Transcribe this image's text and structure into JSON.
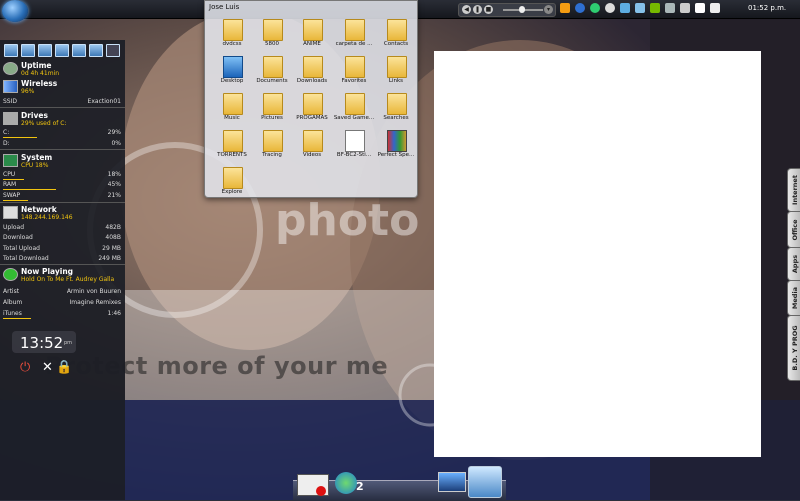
{
  "colors": {
    "accent": "#f1c40f",
    "sidebar": "#1c1e26",
    "panel": "#ffffff"
  },
  "topbar": {
    "clock": "01:52 p.m.",
    "tray_icons": [
      "orange-app-icon",
      "bluetooth-icon",
      "green-app-icon",
      "circle-app-icon",
      "network-icon",
      "network-icon-2",
      "nvidia-icon",
      "shield-icon",
      "device-icon",
      "signal-icon",
      "volume-icon"
    ]
  },
  "sidebar": {
    "uptime": {
      "title": "Uptime",
      "value": "0d 4h 41min"
    },
    "wireless": {
      "title": "Wireless",
      "value": "96%"
    },
    "ssid": {
      "label": "SSID",
      "value": "Exaction01"
    },
    "drives": {
      "title": "Drives",
      "value": "29% used of C:",
      "rows": [
        {
          "label": "C:",
          "value": "29%"
        },
        {
          "label": "D:",
          "value": "0%"
        }
      ]
    },
    "system": {
      "title": "System",
      "value": "CPU 18%",
      "rows": [
        {
          "label": "CPU",
          "value": "18%"
        },
        {
          "label": "RAM",
          "value": "45%"
        },
        {
          "label": "SWAP",
          "value": "21%"
        }
      ]
    },
    "network": {
      "title": "Network",
      "value": "148.244.169.146",
      "rows": [
        {
          "label": "Upload",
          "value": "482B"
        },
        {
          "label": "Download",
          "value": "408B"
        },
        {
          "label": "Total Upload",
          "value": "29 MB"
        },
        {
          "label": "Total Download",
          "value": "249 MB"
        }
      ]
    },
    "now_playing": {
      "title": "Now Playing",
      "value": "Hold On To Me Ft. Audrey Galla",
      "rows": [
        {
          "label": "Artist",
          "value": "Armin von Buuren"
        },
        {
          "label": "Album",
          "value": "Imagine Remixes"
        },
        {
          "label": "iTunes",
          "value": "1:46"
        }
      ]
    }
  },
  "clock_widget": {
    "time": "13:52",
    "suffix": "pm"
  },
  "explorer": {
    "title": "Jose Luis",
    "items": [
      {
        "label": "dvdcss",
        "icon": "folder"
      },
      {
        "label": "5800",
        "icon": "folder"
      },
      {
        "label": "ANIME",
        "icon": "folder"
      },
      {
        "label": "carpeta de ...",
        "icon": "folder"
      },
      {
        "label": "Contacts",
        "icon": "folder"
      },
      {
        "label": "Desktop",
        "icon": "blue"
      },
      {
        "label": "Documents",
        "icon": "folder"
      },
      {
        "label": "Downloads",
        "icon": "folder"
      },
      {
        "label": "Favorites",
        "icon": "folder"
      },
      {
        "label": "Links",
        "icon": "folder"
      },
      {
        "label": "Music",
        "icon": "folder"
      },
      {
        "label": "Pictures",
        "icon": "folder"
      },
      {
        "label": "PROGAMAS",
        "icon": "folder"
      },
      {
        "label": "Saved Game...",
        "icon": "folder"
      },
      {
        "label": "Searches",
        "icon": "folder"
      },
      {
        "label": "TORRENTS",
        "icon": "folder"
      },
      {
        "label": "Tracing",
        "icon": "folder"
      },
      {
        "label": "Videos",
        "icon": "folder"
      },
      {
        "label": "BF-BC2-Sti...",
        "icon": "note"
      },
      {
        "label": "Perfect Spe...",
        "icon": "books"
      },
      {
        "label": "Explore",
        "icon": "folder"
      }
    ]
  },
  "right_tabs": [
    "Internet",
    "Office",
    "Apps",
    "Media",
    "B.D. Y PROG"
  ],
  "dock": {
    "badge": "2"
  },
  "watermark": {
    "text": "Protect more of your me",
    "logo": "photo"
  }
}
